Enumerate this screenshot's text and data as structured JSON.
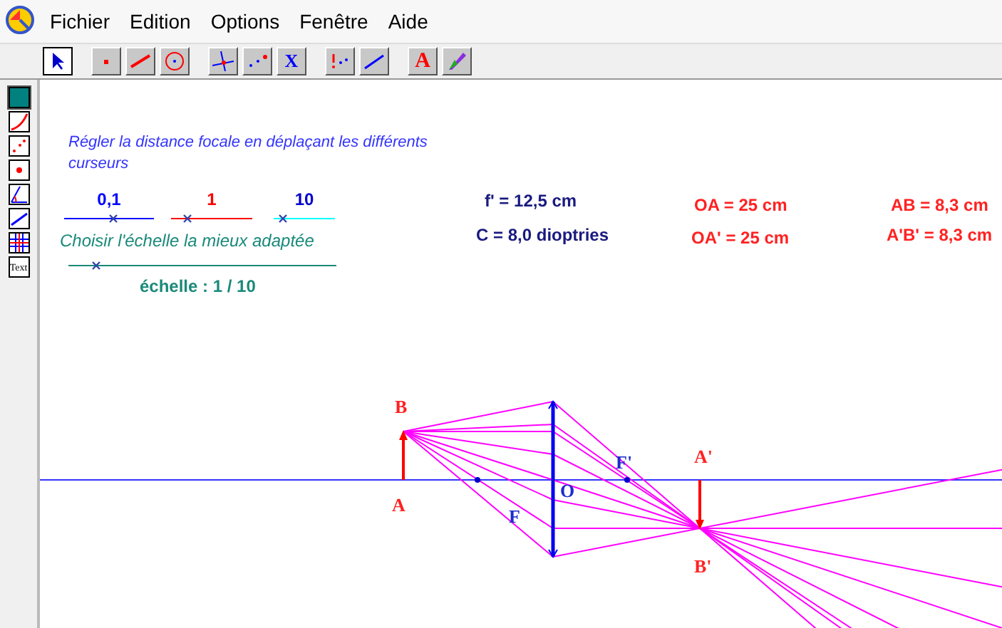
{
  "menu": [
    "Fichier",
    "Edition",
    "Options",
    "Fenêtre",
    "Aide"
  ],
  "tools": [
    {
      "kind": "pointer",
      "selected": true
    },
    {
      "kind": "point",
      "selected": false
    },
    {
      "kind": "segment",
      "selected": false
    },
    {
      "kind": "circle",
      "selected": false
    },
    {
      "kind": "intersect",
      "selected": false
    },
    {
      "kind": "dots",
      "selected": false
    },
    {
      "kind": "measure",
      "selected": false,
      "label": "X"
    },
    {
      "kind": "dots-red",
      "selected": false
    },
    {
      "kind": "line",
      "selected": false
    },
    {
      "kind": "text",
      "selected": false,
      "label": "A"
    },
    {
      "kind": "brush",
      "selected": false
    }
  ],
  "palette": [
    {
      "kind": "swatch",
      "selected": true
    },
    {
      "kind": "curve",
      "selected": false
    },
    {
      "kind": "scatter",
      "selected": false
    },
    {
      "kind": "dot",
      "selected": false
    },
    {
      "kind": "angle",
      "selected": false
    },
    {
      "kind": "line",
      "selected": false
    },
    {
      "kind": "grid",
      "selected": false
    },
    {
      "kind": "text",
      "selected": false,
      "label": "Text"
    }
  ],
  "instruction": "Régler la distance focale en déplaçant les différents curseurs",
  "scale_sliders": [
    {
      "label": "0,1",
      "color": "#0000ff",
      "level": 0.54
    },
    {
      "label": "1",
      "color": "#ff0000",
      "level": 0.2
    },
    {
      "label": "10",
      "color": "#00ffff",
      "level": 0.14
    }
  ],
  "scale_hint": "Choisir l'échelle la mieux adaptée",
  "scale_slider": {
    "level": 0.1
  },
  "scale_reading": "échelle : 1 / 10",
  "lens_values": [
    "f' = 12,5 cm",
    "C = 8,0 dioptries"
  ],
  "distances": [
    "OA = 25 cm",
    "OA' = 25 cm"
  ],
  "sizes": [
    "AB = 8,3 cm",
    "A'B' = 8,3 cm"
  ],
  "diagram": {
    "labels": [
      {
        "text": "B",
        "kind": "object"
      },
      {
        "text": "A",
        "kind": "object"
      },
      {
        "text": "F",
        "kind": "focal"
      },
      {
        "text": "O",
        "kind": "focal"
      },
      {
        "text": "F'",
        "kind": "focal"
      },
      {
        "text": "A'",
        "kind": "object"
      },
      {
        "text": "B'",
        "kind": "object"
      }
    ]
  }
}
